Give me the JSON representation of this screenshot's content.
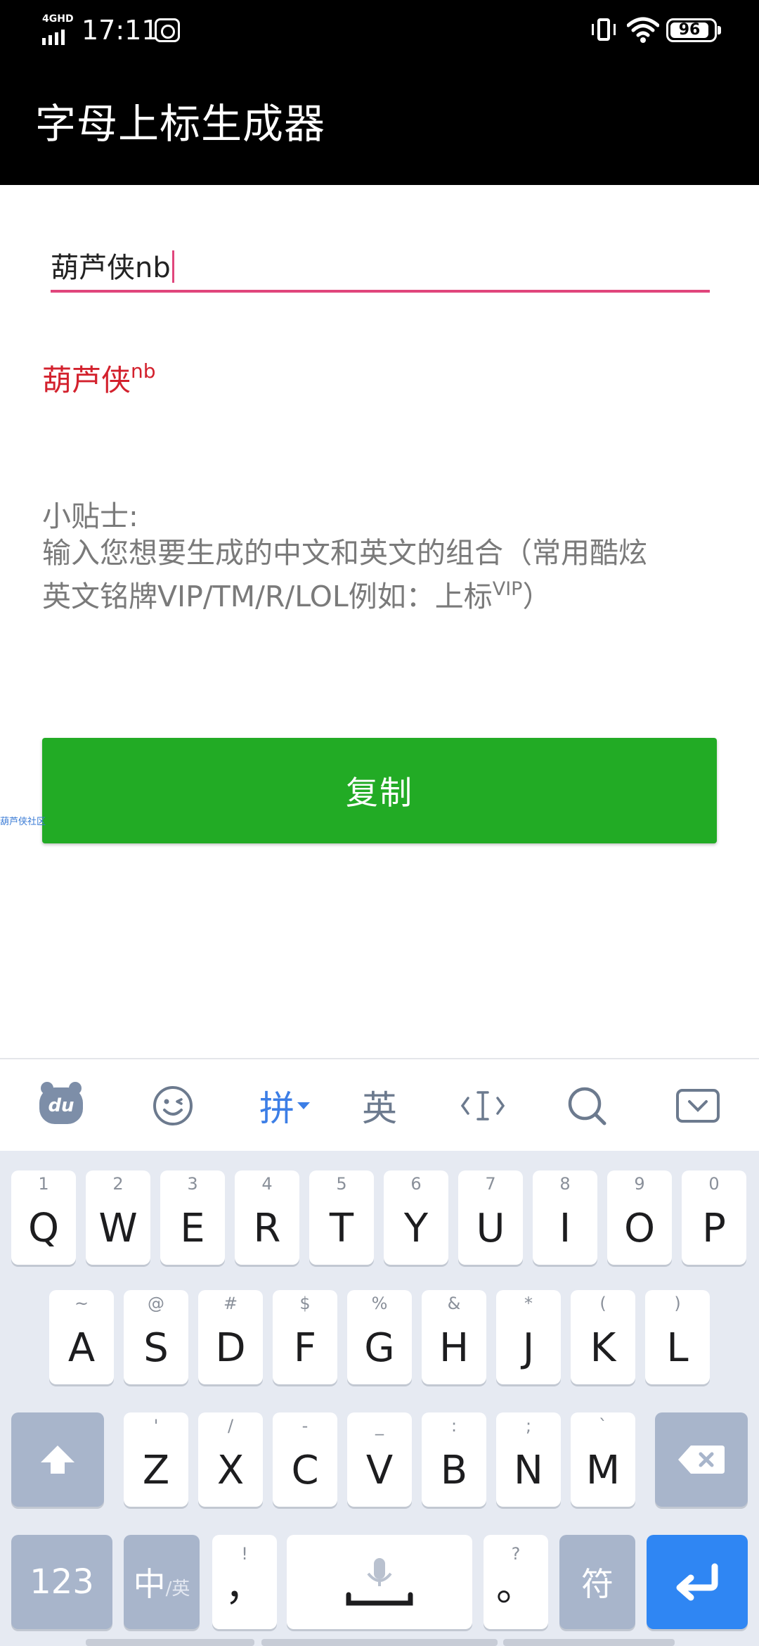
{
  "status_bar": {
    "network": "4GHD",
    "time": "17:11",
    "battery": "96"
  },
  "app_bar": {
    "title": "字母上标生成器"
  },
  "input": {
    "value": "葫芦侠nb"
  },
  "result": {
    "base": "葫芦侠",
    "sup": "nb"
  },
  "tips": {
    "heading": "小贴士:",
    "line1": "输入您想要生成的中文和英文的组合（常用酷炫",
    "line2": "英文铭牌VIP/TM/R/LOL例如：上标",
    "line2_sup": "VIP",
    "line2_end": "）"
  },
  "copy_button": {
    "label": "复制"
  },
  "side_tag": "葫芦侠社区",
  "keyboard_toolbar": {
    "pinyin": "拼",
    "english": "英",
    "icons": [
      "du-logo-icon",
      "emoji-icon",
      "cursor-icon",
      "search-icon",
      "collapse-keyboard-icon"
    ]
  },
  "keyboard": {
    "row1": [
      {
        "main": "Q",
        "sub": "1"
      },
      {
        "main": "W",
        "sub": "2"
      },
      {
        "main": "E",
        "sub": "3"
      },
      {
        "main": "R",
        "sub": "4"
      },
      {
        "main": "T",
        "sub": "5"
      },
      {
        "main": "Y",
        "sub": "6"
      },
      {
        "main": "U",
        "sub": "7"
      },
      {
        "main": "I",
        "sub": "8"
      },
      {
        "main": "O",
        "sub": "9"
      },
      {
        "main": "P",
        "sub": "0"
      }
    ],
    "row2": [
      {
        "main": "A",
        "sub": "~"
      },
      {
        "main": "S",
        "sub": "@"
      },
      {
        "main": "D",
        "sub": "#"
      },
      {
        "main": "F",
        "sub": "$"
      },
      {
        "main": "G",
        "sub": "%"
      },
      {
        "main": "H",
        "sub": "&"
      },
      {
        "main": "J",
        "sub": "*"
      },
      {
        "main": "K",
        "sub": "("
      },
      {
        "main": "L",
        "sub": ")"
      }
    ],
    "row3": [
      {
        "main": "Z",
        "sub": "'"
      },
      {
        "main": "X",
        "sub": "/"
      },
      {
        "main": "C",
        "sub": "-"
      },
      {
        "main": "V",
        "sub": "_"
      },
      {
        "main": "B",
        "sub": ":"
      },
      {
        "main": "N",
        "sub": ";"
      },
      {
        "main": "M",
        "sub": "`"
      }
    ],
    "row4": {
      "num": "123",
      "lang_main": "中",
      "lang_sub": "/英",
      "comma_main": "，",
      "comma_sub": "!",
      "period_main": "。",
      "period_sub": "?",
      "symbol": "符"
    }
  },
  "colors": {
    "accent": "#e0467c",
    "result": "#d3212d",
    "button": "#22ab25",
    "enter_key": "#2f86f3"
  }
}
